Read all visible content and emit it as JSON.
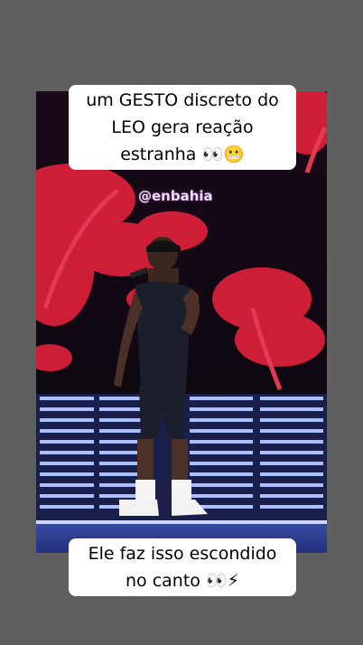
{
  "story": {
    "top_caption": [
      "um GESTO discreto do",
      "LEO gera reação",
      "estranha 👀😬"
    ],
    "watermark_handle": "@enbahia",
    "bottom_caption": [
      "Ele faz isso escondido",
      "no canto 👀⚡"
    ]
  },
  "colors": {
    "background": "#5f5f5f",
    "stage_red": "#d8203a",
    "led_blue": "#9fb6ff",
    "caption_bg": "#ffffff"
  }
}
